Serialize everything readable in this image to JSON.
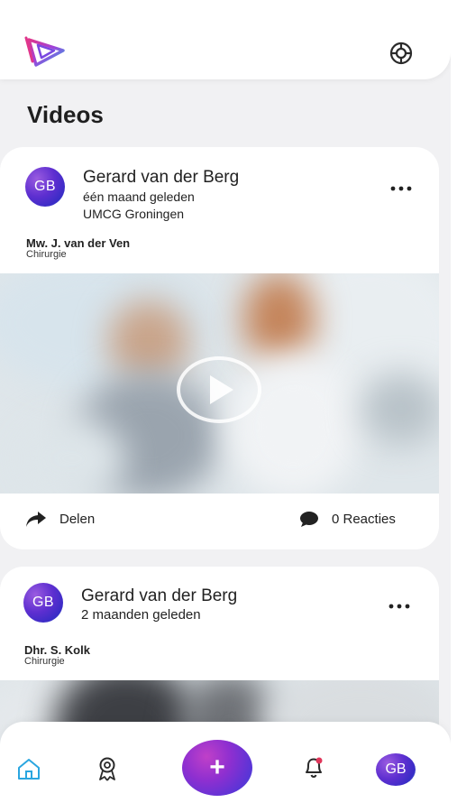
{
  "header": {
    "logo_icon": "play-triangle-logo-icon",
    "help_icon": "lifebuoy-icon"
  },
  "page": {
    "title": "Videos"
  },
  "posts": [
    {
      "avatar": "GB",
      "author": "Gerard van der Berg",
      "time": "één maand geleden",
      "location": "UMCG Groningen",
      "patient": "Mw. J. van der Ven",
      "department": "Chirurgie",
      "share_label": "Delen",
      "comments_label": "0 Reacties"
    },
    {
      "avatar": "GB",
      "author": "Gerard van der Berg",
      "time": "2 maanden geleden",
      "patient": "Dhr. S. Kolk",
      "department": "Chirurgie"
    }
  ],
  "nav": {
    "home_icon": "home-icon",
    "award_icon": "award-icon",
    "add_label": "+",
    "notifications_icon": "bell-icon",
    "notification_dot_color": "#e0365a",
    "profile_avatar": "GB"
  },
  "colors": {
    "accent_purple": "#5e2fd0",
    "accent_blue": "#2aa6e0",
    "home_active": "#2aa6e0"
  }
}
